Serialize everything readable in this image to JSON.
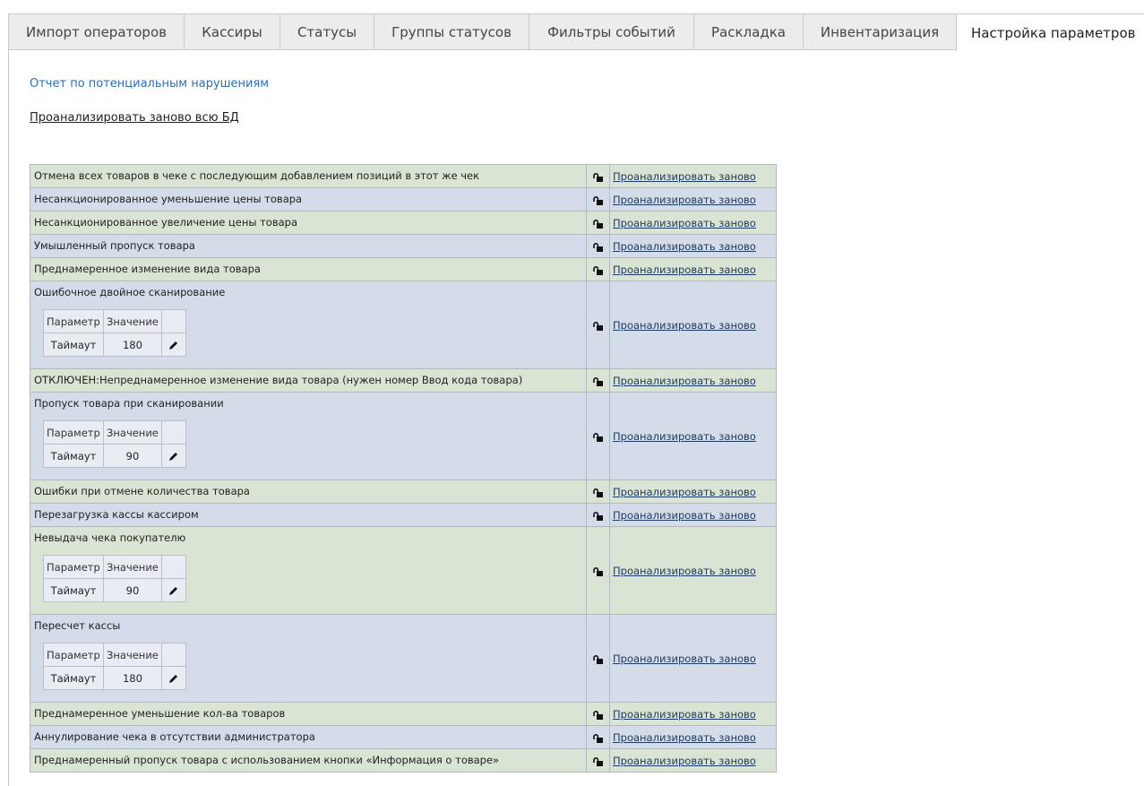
{
  "tabs": [
    {
      "label": "Импорт операторов",
      "active": false
    },
    {
      "label": "Кассиры",
      "active": false
    },
    {
      "label": "Статусы",
      "active": false
    },
    {
      "label": "Группы статусов",
      "active": false
    },
    {
      "label": "Фильтры событий",
      "active": false
    },
    {
      "label": "Раскладка",
      "active": false
    },
    {
      "label": "Инвентаризация",
      "active": false
    },
    {
      "label": "Настройка параметров",
      "active": true
    }
  ],
  "links": {
    "report": "Отчет по потенциальным нарушениям",
    "reanalyze_all": "Проанализировать заново всю БД"
  },
  "row_action_label": "Проанализировать заново",
  "param_headers": {
    "param": "Параметр",
    "value": "Значение"
  },
  "rules": [
    {
      "name": "Отмена всех товаров в чеке с последующим добавлением позиций в этот же чек"
    },
    {
      "name": "Несанкционированное уменьшение цены товара"
    },
    {
      "name": "Несанкционированное увеличение цены товара"
    },
    {
      "name": "Умышленный пропуск товара"
    },
    {
      "name": "Преднамеренное изменение вида товара"
    },
    {
      "name": "Ошибочное двойное сканирование",
      "params": [
        {
          "name": "Таймаут",
          "value": "180"
        }
      ]
    },
    {
      "name": "ОТКЛЮЧЕН:Непреднамеренное изменение вида товара (нужен номер Ввод кода товара)"
    },
    {
      "name": "Пропуск товара при сканировании",
      "params": [
        {
          "name": "Таймаут",
          "value": "90"
        }
      ]
    },
    {
      "name": "Ошибки при отмене количества товара"
    },
    {
      "name": "Перезагрузка кассы кассиром"
    },
    {
      "name": "Невыдача чека покупателю",
      "params": [
        {
          "name": "Таймаут",
          "value": "90"
        }
      ]
    },
    {
      "name": "Пересчет кассы",
      "params": [
        {
          "name": "Таймаут",
          "value": "180"
        }
      ]
    },
    {
      "name": "Преднамеренное уменьшение кол-ва товаров"
    },
    {
      "name": "Аннулирование чека в отсутствии администратора"
    },
    {
      "name": "Преднамеренный пропуск товара с использованием кнопки «Информация о товаре»"
    }
  ],
  "icons": {
    "lock": "lock-open-icon",
    "edit": "pencil-icon"
  },
  "colors": {
    "row_green": "#d9e4d4",
    "row_blue": "#d3dce8",
    "link_blue": "#2a6eb8"
  }
}
